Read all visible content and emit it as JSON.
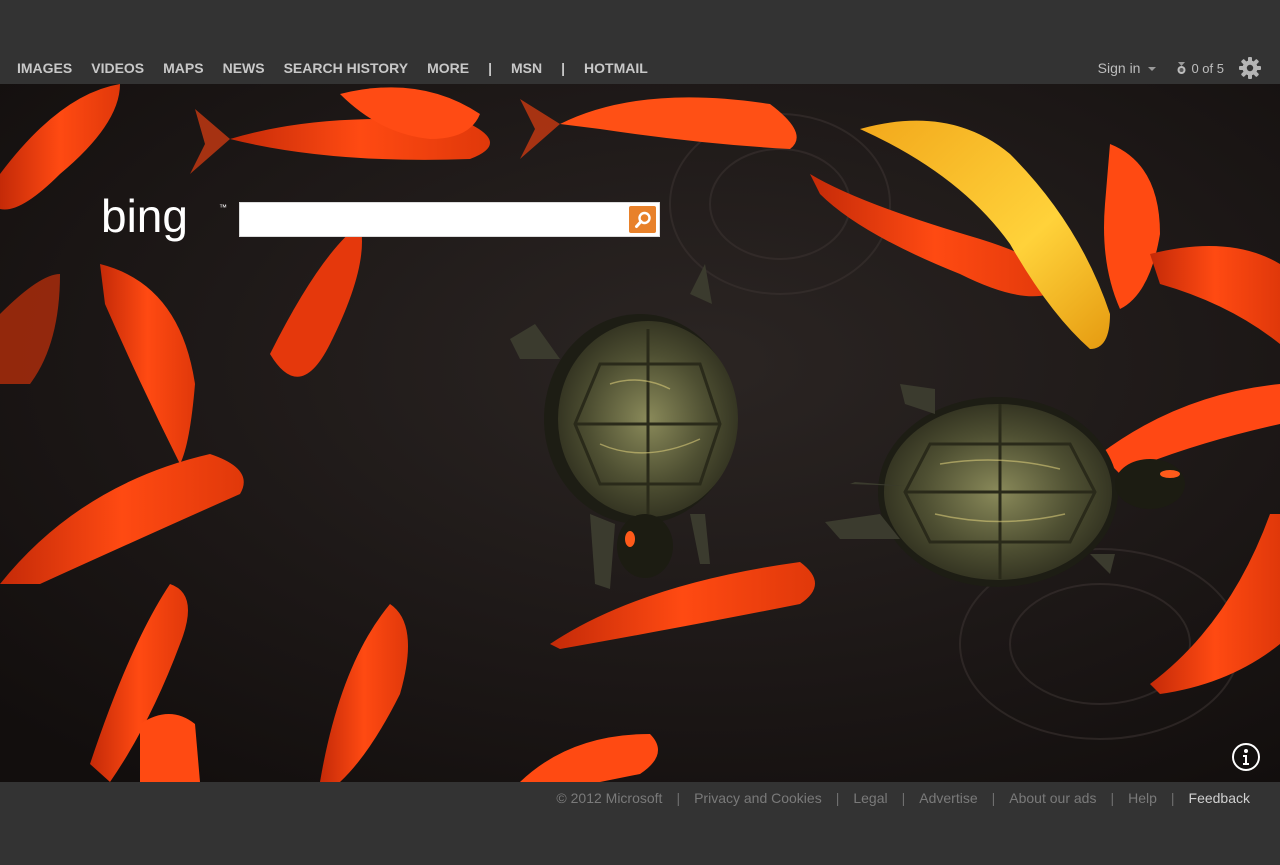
{
  "nav": {
    "items": [
      "IMAGES",
      "VIDEOS",
      "MAPS",
      "NEWS",
      "SEARCH HISTORY",
      "MORE"
    ],
    "separator": "|",
    "msn": "MSN",
    "hotmail": "HOTMAIL"
  },
  "header": {
    "signin_label": "Sign in",
    "rewards_label": "0 of 5"
  },
  "logo": {
    "text": "bing",
    "trademark": "™"
  },
  "search": {
    "value": "",
    "placeholder": ""
  },
  "footer": {
    "copyright": "© 2012 Microsoft",
    "links": [
      "Privacy and Cookies",
      "Legal",
      "Advertise",
      "About our ads",
      "Help"
    ],
    "feedback": "Feedback",
    "separator": "|"
  },
  "colors": {
    "bar_background": "#333333",
    "accent_orange": "#e8812a",
    "nav_text": "#c8c8c8"
  },
  "icons": [
    "search-icon",
    "gear-icon",
    "rewards-medal-icon",
    "info-icon",
    "chevron-down-icon"
  ]
}
